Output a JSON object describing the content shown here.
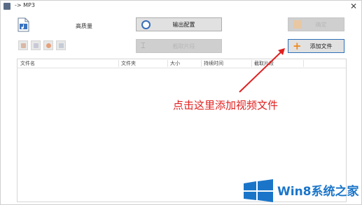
{
  "window": {
    "title": "-> MP3",
    "close_glyph": "✕"
  },
  "toolbar": {
    "quality_label": "高质量",
    "output_button": "输出配置",
    "cut_button": "截取片段",
    "ok_button": "确定",
    "add_button": "添加文件",
    "small_tools": [
      "tool-doc-icon",
      "tool-doc-icon",
      "tool-gear-icon",
      "tool-info-icon"
    ]
  },
  "table": {
    "columns": [
      "文件名",
      "文件夹",
      "大小",
      "持续时间",
      "截取片段"
    ],
    "rows": []
  },
  "annotation": {
    "text": "点击这里添加视频文件",
    "color": "#e02020"
  },
  "watermark": {
    "text": "Win8系统之家",
    "color": "#1a75c9"
  },
  "colors": {
    "accent": "#2d6fb7",
    "plus": "#f08a1a"
  }
}
